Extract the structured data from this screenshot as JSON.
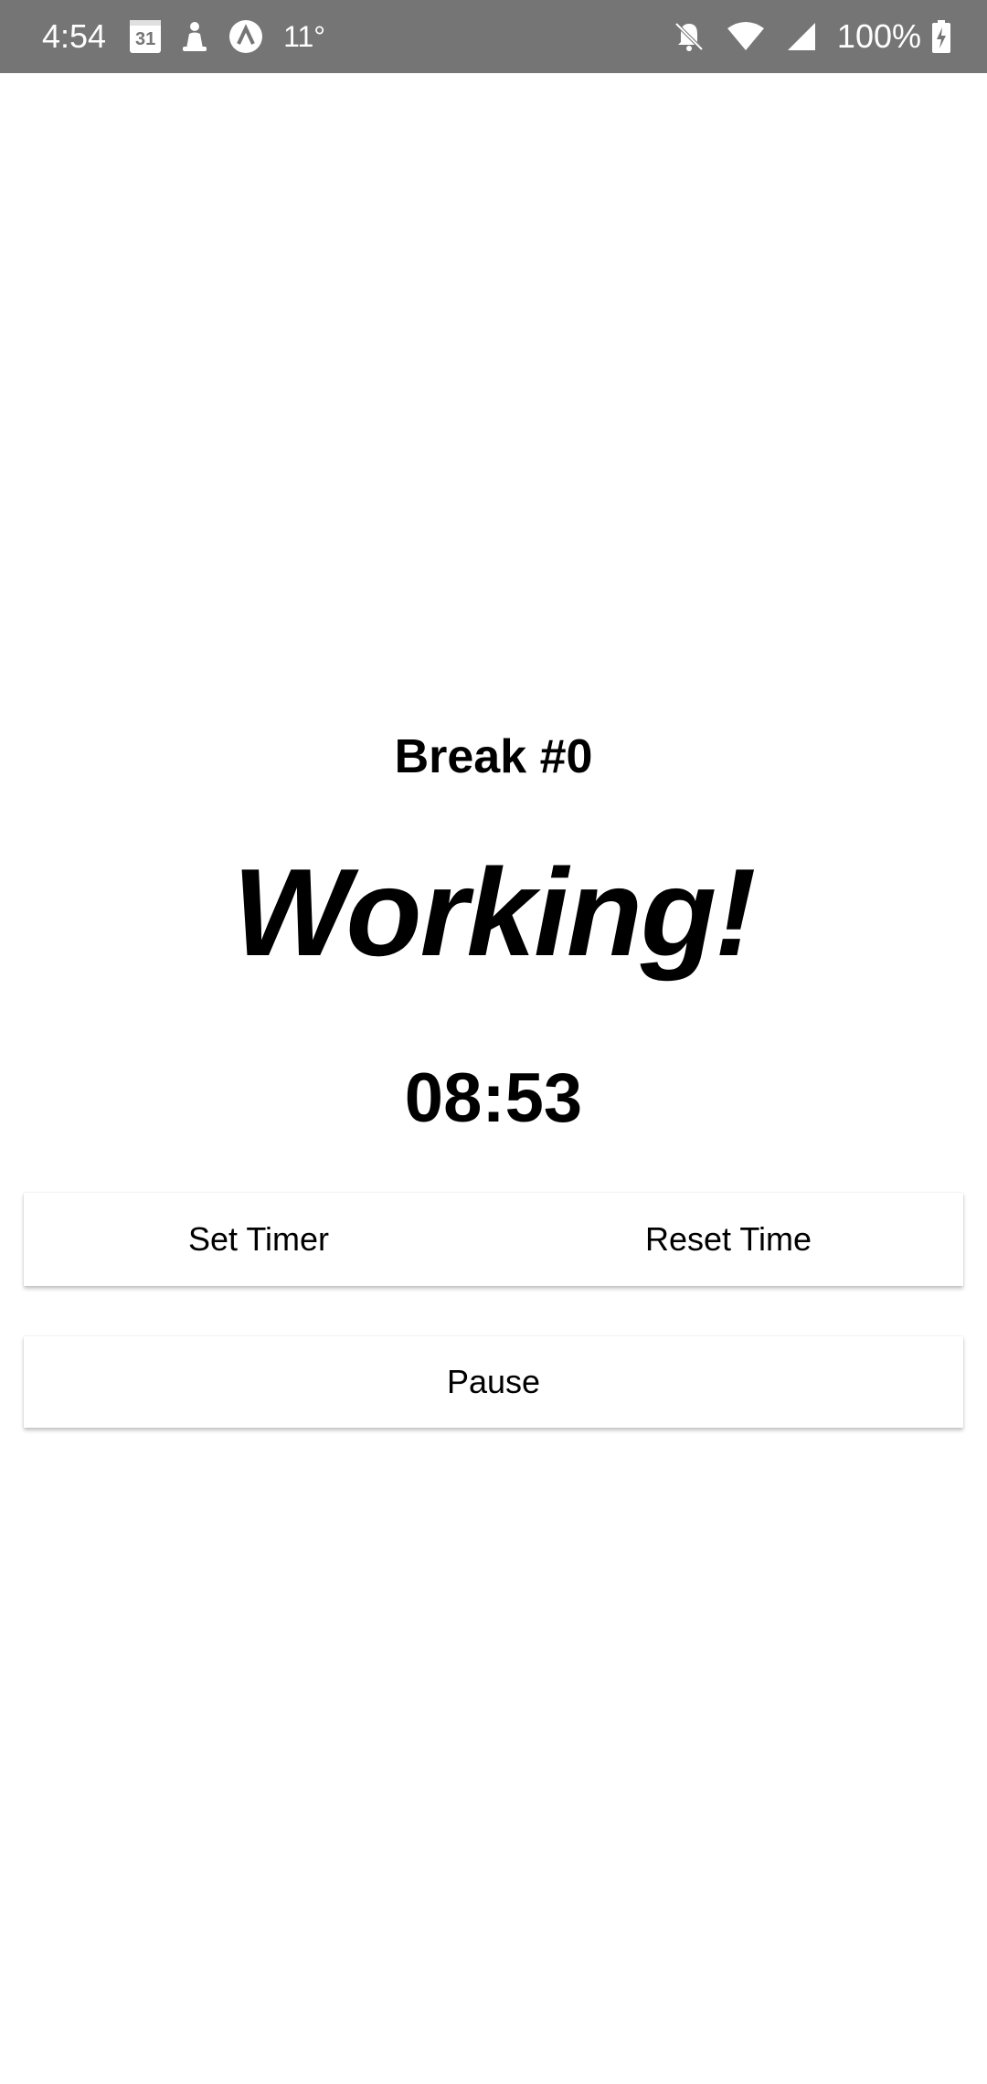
{
  "status_bar": {
    "time": "4:54",
    "calendar_day": "31",
    "temperature": "11°",
    "battery": "100%",
    "icons": [
      "calendar-icon",
      "meditation-icon",
      "app-icon",
      "bell-off-icon",
      "wifi-icon",
      "signal-icon",
      "battery-charging-icon"
    ]
  },
  "main": {
    "break_label": "Break #0",
    "state_label": "Working!",
    "timer": "08:53"
  },
  "buttons": {
    "set_timer": "Set Timer",
    "reset_time": "Reset Time",
    "pause": "Pause"
  },
  "colors": {
    "status_bar_bg": "#757575",
    "background": "#ffffff",
    "text": "#000000"
  }
}
